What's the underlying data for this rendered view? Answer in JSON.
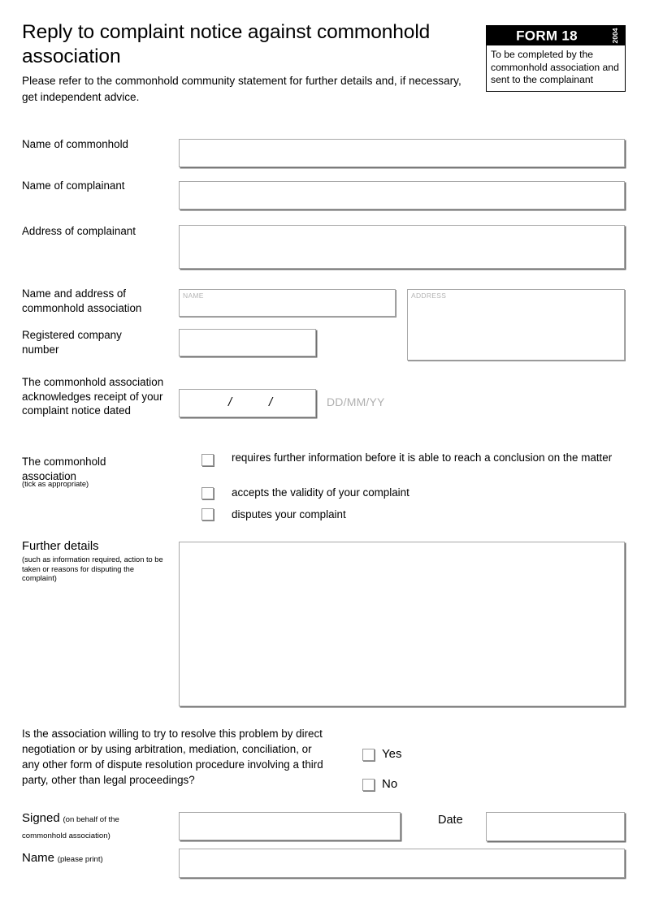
{
  "header": {
    "title": "Reply to complaint notice against commonhold association",
    "subtitle": "Please refer to the commonhold community statement for further details and, if necessary, get independent advice.",
    "badge": {
      "form_number": "FORM 18",
      "year": "2004",
      "note": "To be completed by the commonhold association and sent to the complainant"
    }
  },
  "fields": {
    "name_of_commonhold": {
      "label": "Name of commonhold",
      "value": ""
    },
    "name_of_complainant": {
      "label": "Name of complainant",
      "value": ""
    },
    "address_of_complainant": {
      "label": "Address of complainant",
      "value": ""
    },
    "association_name_address": {
      "label_line1": "Name and address of",
      "label_line2": "commonhold association",
      "name_placeholder": "NAME",
      "name_value": "",
      "address_placeholder": "ADDRESS",
      "address_value": ""
    },
    "registered_company_number": {
      "label_line1": "Registered company",
      "label_line2": "number",
      "value": ""
    },
    "receipt_date": {
      "label": "The commonhold association acknowledges receipt of your complaint notice dated",
      "separator_1": "/",
      "separator_2": "/",
      "format_hint": "DD/MM/YY",
      "value": ""
    }
  },
  "association_response": {
    "label_line1": "The commonhold",
    "label_line2": "association",
    "sub_label": "(tick as appropriate)",
    "options": [
      {
        "label": "requires further information before it is able to reach a conclusion on the matter",
        "checked": false
      },
      {
        "label": "accepts the validity of your complaint",
        "checked": false
      },
      {
        "label": "disputes your complaint",
        "checked": false
      }
    ]
  },
  "further_details": {
    "label": "Further details",
    "sub_label": "(such as information required, action to be taken or reasons for disputing the complaint)",
    "value": ""
  },
  "dispute_resolution": {
    "question": "Is the association willing to try to resolve this problem by direct negotiation or by using arbitration, mediation, conciliation, or any other form of dispute resolution procedure involving a third party, other than legal proceedings?",
    "options": [
      {
        "label": "Yes",
        "checked": false
      },
      {
        "label": "No",
        "checked": false
      }
    ]
  },
  "signature_block": {
    "signed_label": "Signed",
    "signed_sub_line1": "(on behalf of the",
    "signed_sub_line2": "commonhold association)",
    "signed_value": "",
    "date_label": "Date",
    "date_value": "",
    "name_label": "Name",
    "name_sub": "(please print)",
    "name_value": ""
  }
}
